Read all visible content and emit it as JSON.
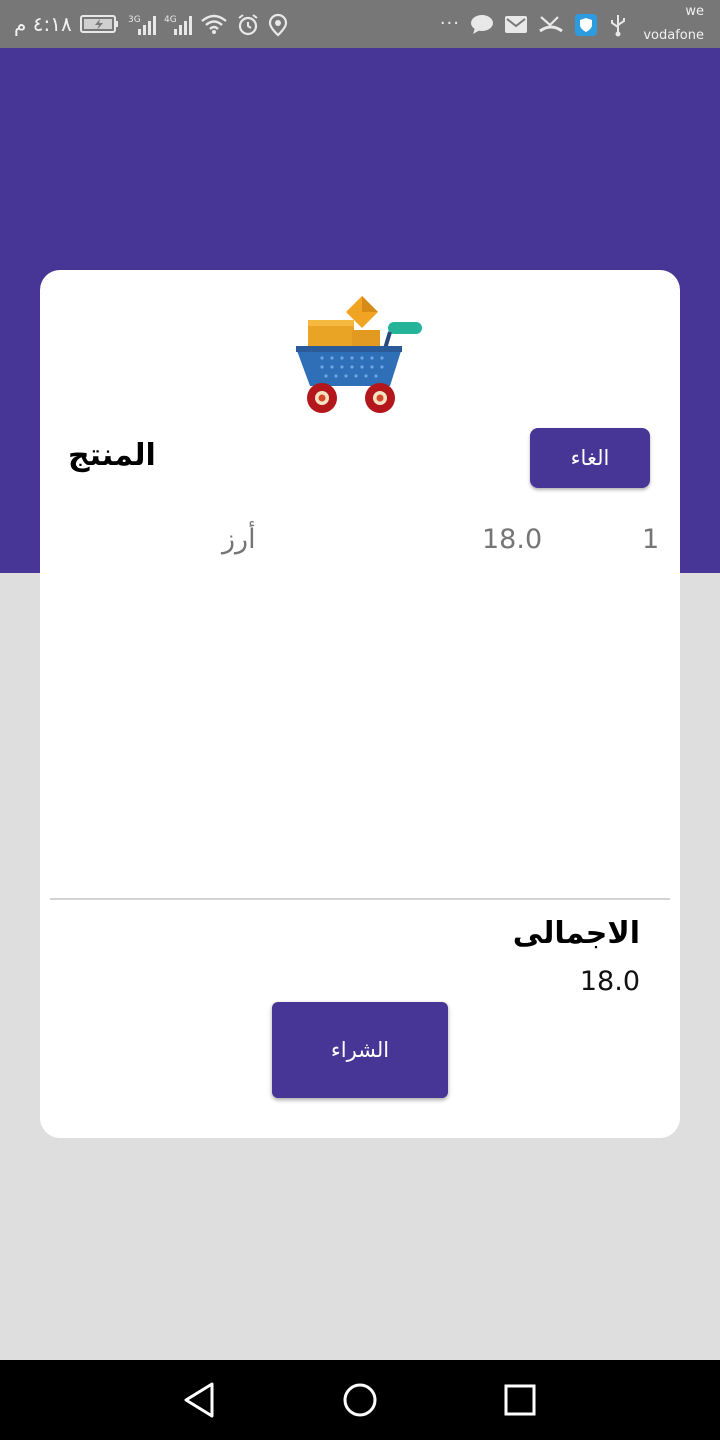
{
  "status_bar": {
    "time": "٤:١٨ م",
    "carrier_line1": "we",
    "carrier_line2": "vodafone",
    "net1": "3G",
    "net2": "4G",
    "overflow": "···"
  },
  "dialog": {
    "cancel_label": "الغاء",
    "product_heading": "المنتج",
    "items": [
      {
        "name": "أرز",
        "price": "18.0",
        "qty": "1"
      }
    ],
    "total_label": "الاجمالى",
    "total_value": "18.0",
    "buy_label": "الشراء"
  },
  "icons": {
    "cart": "shopping-cart-icon",
    "back": "back-icon",
    "home": "home-icon",
    "recents": "recents-icon"
  },
  "colors": {
    "primary": "#483697",
    "background": "#dedede",
    "status_bar": "#777777"
  }
}
